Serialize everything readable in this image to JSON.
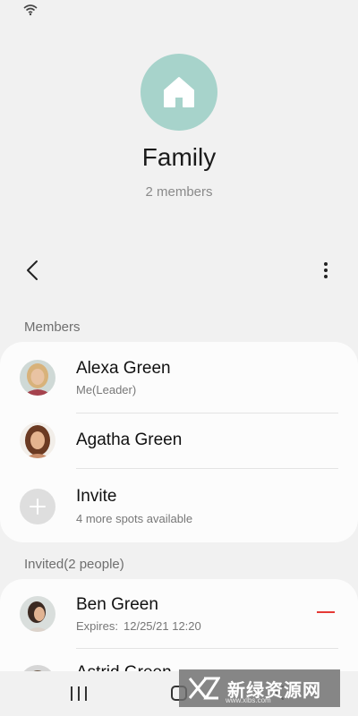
{
  "status_bar": {
    "wifi_icon": "wifi-icon"
  },
  "header": {
    "group_icon": "home-icon",
    "group_color": "#a7d3cb",
    "title": "Family",
    "member_count": "2 members"
  },
  "toolbar": {
    "back_icon": "chevron-left-icon",
    "more_icon": "more-vertical-icon"
  },
  "members": {
    "label": "Members",
    "items": [
      {
        "name": "Alexa Green",
        "subtitle": "Me(Leader)"
      },
      {
        "name": "Agatha Green",
        "subtitle": ""
      },
      {
        "name": "Invite",
        "subtitle": "4 more spots available"
      }
    ]
  },
  "invited": {
    "label": "Invited(2 people)",
    "items": [
      {
        "name": "Ben Green",
        "expires_label": "Expires:",
        "expires_value": "12/25/21 12:20"
      },
      {
        "name": "Astrid Green"
      }
    ]
  },
  "watermark": {
    "text": "新绿资源网",
    "sub": "www.xlbs.com"
  },
  "colors": {
    "accent_remove": "#e53935",
    "card_bg": "#fcfcfc",
    "page_bg": "#f1f1f1"
  }
}
